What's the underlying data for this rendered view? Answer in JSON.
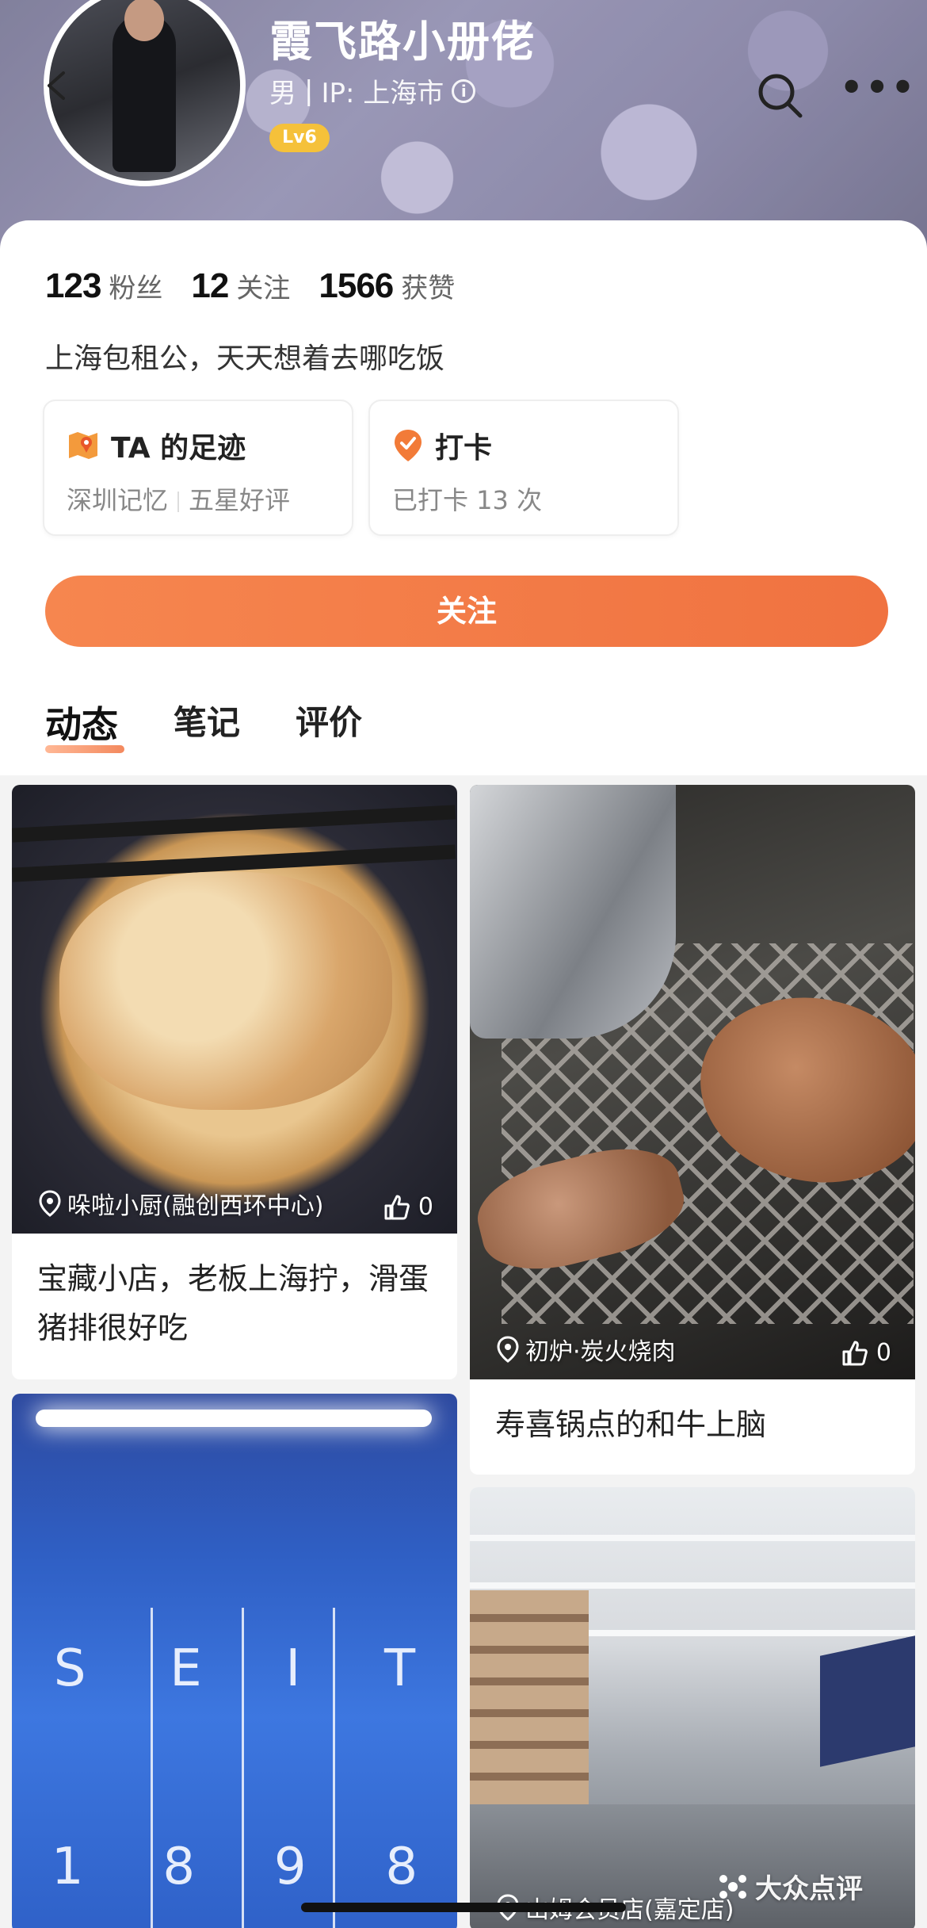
{
  "header": {
    "name": "霞飞路小册佬",
    "gender": "男",
    "ip_label": "IP: 上海市",
    "level": "Lv6"
  },
  "stats": [
    {
      "value": "123",
      "label": "粉丝"
    },
    {
      "value": "12",
      "label": "关注"
    },
    {
      "value": "1566",
      "label": "获赞"
    }
  ],
  "bio": "上海包租公，天天想着去哪吃饭",
  "features": {
    "footprint": {
      "title": "TA 的足迹",
      "sub_a": "深圳记忆",
      "sub_b": "五星好评"
    },
    "checkin": {
      "title": "打卡",
      "sub": "已打卡 13 次"
    }
  },
  "follow_label": "关注",
  "tabs": [
    "动态",
    "笔记",
    "评价"
  ],
  "feed": [
    {
      "location": "哚啦小厨(融创西环中心)",
      "likes": "0",
      "title": "宝藏小店，老板上海拧，滑蛋猪排很好吃"
    },
    {
      "location": "初炉·炭火烧肉",
      "likes": "0",
      "title": "寿喜锅点的和牛上脑"
    },
    {
      "letters": [
        "S",
        "E",
        "I",
        "T"
      ],
      "digits": [
        "1",
        "8",
        "9",
        "8"
      ]
    },
    {
      "location": "山姆会员店(嘉定店)"
    }
  ],
  "watermark": "大众点评"
}
